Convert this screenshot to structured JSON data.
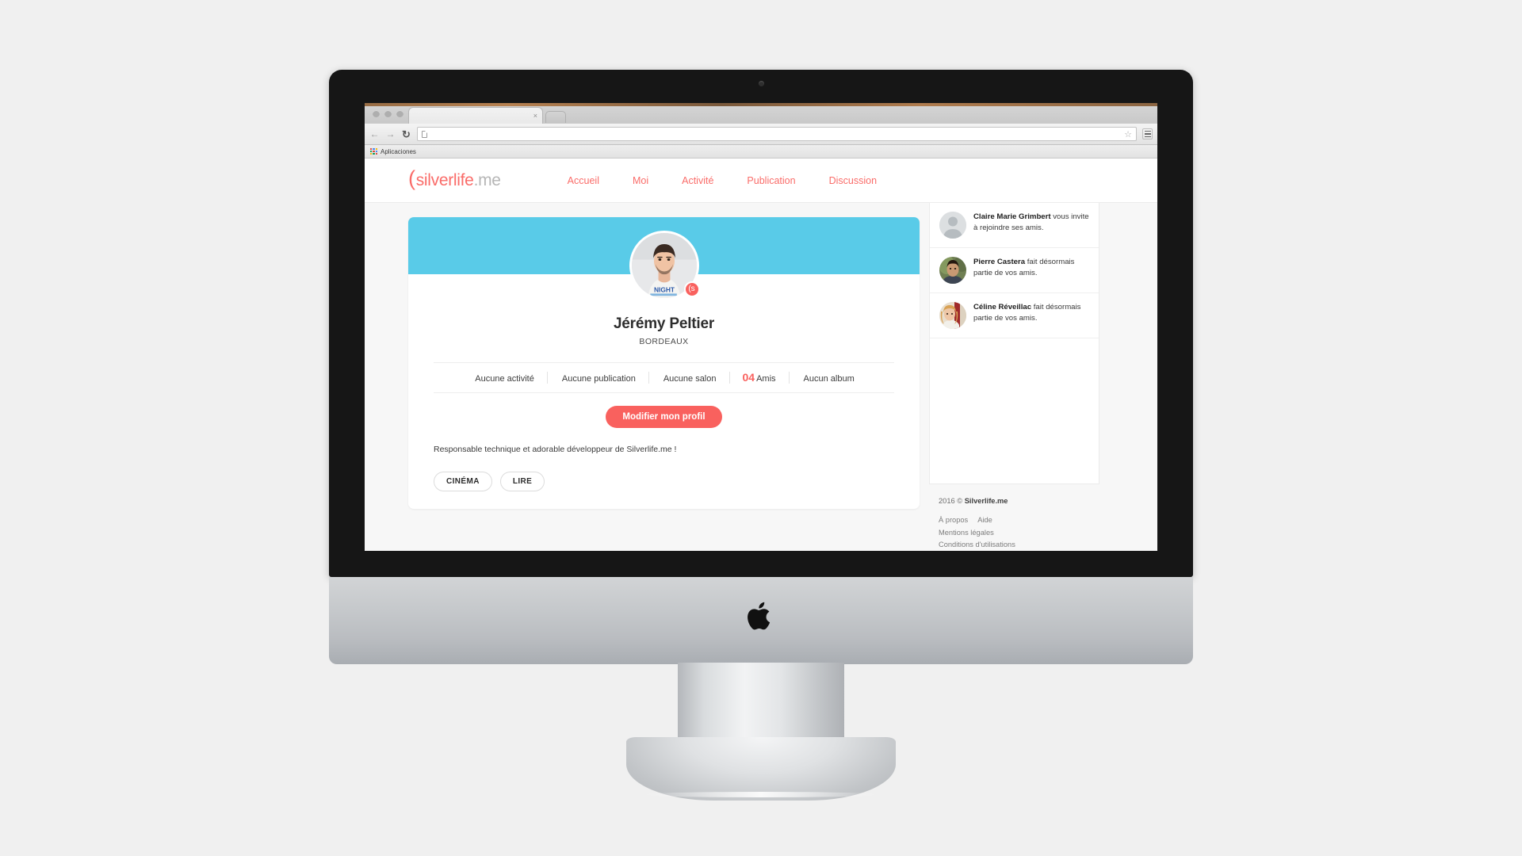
{
  "browser": {
    "tab_title": "",
    "tab_close_label": "×",
    "back_label": "←",
    "forward_label": "→",
    "reload_label": "↻",
    "url_value": "",
    "url_placeholder": "",
    "star_label": "☆",
    "bookmark_label": "Aplicaciones"
  },
  "site": {
    "logo": {
      "paren": "(",
      "brand": "silverlife",
      "tld": ".me"
    },
    "nav": [
      {
        "label": "Accueil"
      },
      {
        "label": "Moi"
      },
      {
        "label": "Activité"
      },
      {
        "label": "Publication"
      },
      {
        "label": "Discussion"
      }
    ]
  },
  "profile": {
    "name": "Jérémy Peltier",
    "city": "BORDEAUX",
    "badge_label": "(s",
    "stats": [
      {
        "count": "",
        "label": "Aucune activité"
      },
      {
        "count": "",
        "label": "Aucune publication"
      },
      {
        "count": "",
        "label": "Aucune salon"
      },
      {
        "count": "04",
        "label": "Amis"
      },
      {
        "count": "",
        "label": "Aucun album"
      }
    ],
    "edit_button": "Modifier mon profil",
    "bio": "Responsable technique et adorable développeur de Silverlife.me !",
    "tags": [
      {
        "label": "CINÉMA"
      },
      {
        "label": "LIRE"
      }
    ]
  },
  "notifications": [
    {
      "name": "Claire Marie Grimbert",
      "text": " vous invite à rejoindre ses amis.",
      "avatar": "placeholder"
    },
    {
      "name": "Pierre Castera",
      "text": " fait désormais partie de vos amis.",
      "avatar": "photo-male"
    },
    {
      "name": "Céline Réveillac",
      "text": " fait désormais partie de vos amis.",
      "avatar": "photo-female"
    }
  ],
  "footer": {
    "copyright_year": "2016 © ",
    "copyright_brand": "Silverlife.me",
    "links_row1": [
      {
        "label": "À propos"
      },
      {
        "label": "Aide"
      }
    ],
    "links_row2": [
      {
        "label": "Mentions légales"
      }
    ],
    "links_row3": [
      {
        "label": "Conditions d'utilisations"
      }
    ]
  },
  "colors": {
    "accent": "#f9615e",
    "cover": "#59cbe8",
    "logo_gray": "#b6b6b6"
  }
}
